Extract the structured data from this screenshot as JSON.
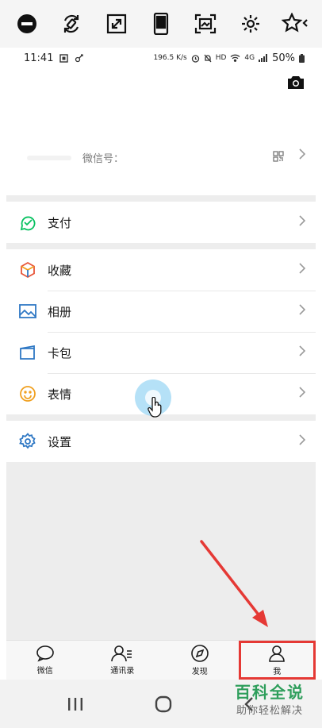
{
  "status_bar": {
    "time": "11:41",
    "net_speed": "196.5 K/s",
    "net": "HD",
    "signal": "4G",
    "battery": "50%"
  },
  "profile": {
    "wechat_id_label": "微信号："
  },
  "menu": {
    "pay": "支付",
    "favorites": "收藏",
    "album": "相册",
    "cards": "卡包",
    "stickers": "表情",
    "settings": "设置"
  },
  "tabs": [
    {
      "label": "微信"
    },
    {
      "label": "通讯录"
    },
    {
      "label": "发现"
    },
    {
      "label": "我"
    }
  ],
  "watermark": {
    "title": "百科全说",
    "subtitle": "助你轻松解决"
  },
  "colors": {
    "pay_green": "#07c160",
    "arrow_red": "#e53935",
    "icon_blue": "#2f78c4",
    "sticker_orange": "#f0a020"
  }
}
